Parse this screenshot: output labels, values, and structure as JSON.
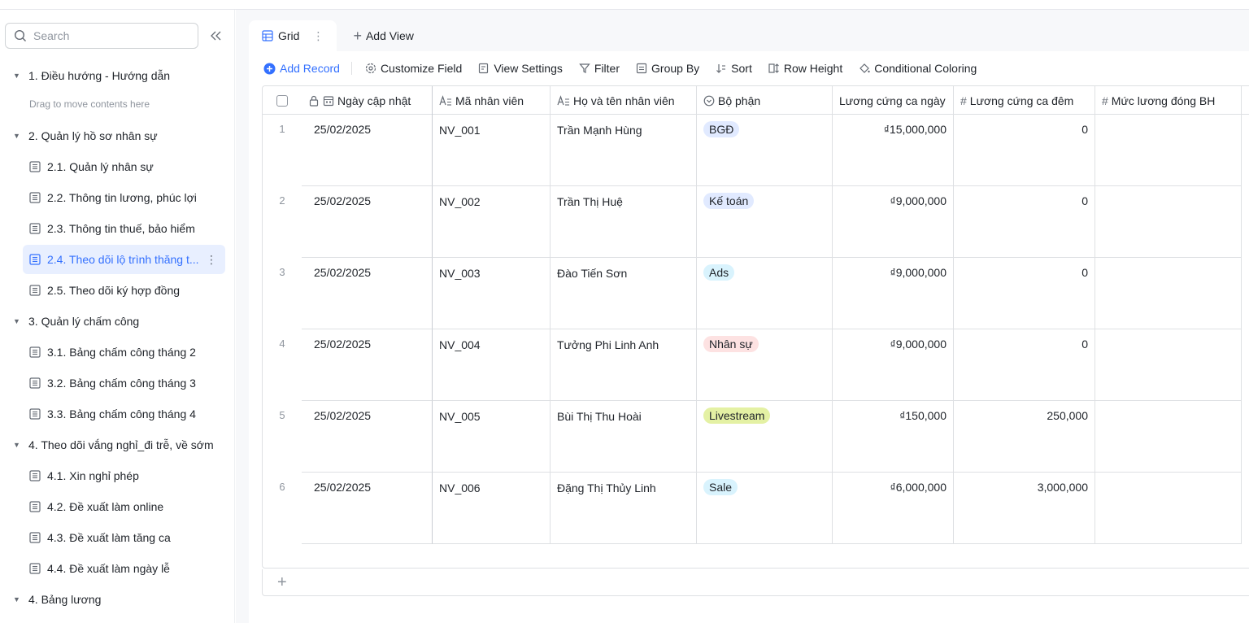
{
  "sidebar": {
    "search_placeholder": "Search",
    "drag_hint": "Drag to move contents here",
    "groups": [
      {
        "label": "1. Điều hướng - Hướng dẫn"
      },
      {
        "label": "2. Quản lý hồ sơ nhân sự"
      },
      {
        "label": "3. Quản lý chấm công"
      },
      {
        "label": "4. Theo dõi vắng nghỉ_đi trễ, về sớm"
      },
      {
        "label": "4. Bảng lương"
      }
    ],
    "items": [
      {
        "label": "2.1. Quản lý nhân sự"
      },
      {
        "label": "2.2. Thông tin lương, phúc lợi"
      },
      {
        "label": "2.3. Thông tin thuế, bảo hiểm"
      },
      {
        "label": "2.4. Theo dõi lộ trình thăng t..."
      },
      {
        "label": "2.5. Theo dõi ký hợp đồng"
      },
      {
        "label": "3.1. Bảng chấm công tháng 2"
      },
      {
        "label": "3.2. Bảng chấm công tháng 3"
      },
      {
        "label": "3.3. Bảng chấm công tháng 4"
      },
      {
        "label": "4.1. Xin nghỉ phép"
      },
      {
        "label": "4.2. Đề xuất làm online"
      },
      {
        "label": "4.3. Đề xuất làm tăng ca"
      },
      {
        "label": "4.4. Đề xuất làm ngày lễ"
      }
    ]
  },
  "tabs": {
    "grid_label": "Grid",
    "add_view_label": "Add View"
  },
  "toolbar": {
    "add_record": "Add Record",
    "customize_field": "Customize Field",
    "view_settings": "View Settings",
    "filter": "Filter",
    "group_by": "Group By",
    "sort": "Sort",
    "row_height": "Row Height",
    "conditional_coloring": "Conditional Coloring"
  },
  "table": {
    "headers": [
      "Ngày cập nhật",
      "Mã nhân viên",
      "Họ và tên nhân viên",
      "Bộ phận",
      "Lương cứng ca ngày",
      "Lương cứng ca đêm",
      "Mức lương đóng BH"
    ],
    "rows": [
      {
        "n": "1",
        "date": "25/02/2025",
        "id": "NV_001",
        "name": "Trần Mạnh Hùng",
        "dept": "BGĐ",
        "day": "₫15,000,000",
        "night": "0"
      },
      {
        "n": "2",
        "date": "25/02/2025",
        "id": "NV_002",
        "name": "Trần Thị Huệ",
        "dept": "Kế toán",
        "day": "₫9,000,000",
        "night": "0"
      },
      {
        "n": "3",
        "date": "25/02/2025",
        "id": "NV_003",
        "name": "Đào Tiến Sơn",
        "dept": "Ads",
        "day": "₫9,000,000",
        "night": "0"
      },
      {
        "n": "4",
        "date": "25/02/2025",
        "id": "NV_004",
        "name": "Tưởng Phi Linh Anh",
        "dept": "Nhân sự",
        "day": "₫9,000,000",
        "night": "0"
      },
      {
        "n": "5",
        "date": "25/02/2025",
        "id": "NV_005",
        "name": "Bùi Thị Thu Hoài",
        "dept": "Livestream",
        "day": "₫150,000",
        "night": "250,000"
      },
      {
        "n": "6",
        "date": "25/02/2025",
        "id": "NV_006",
        "name": "Đặng Thị Thủy Linh",
        "dept": "Sale",
        "day": "₫6,000,000",
        "night": "3,000,000"
      }
    ]
  },
  "colors": {
    "accent": "#3370ff",
    "tag_bgd": "#e1eaff",
    "tag_ketoan": "#e1eaff",
    "tag_ads": "#d9f3fd",
    "tag_nhansu": "#fde2e2",
    "tag_livestream": "#e4f1a4",
    "tag_sale": "#d9f3fd"
  }
}
